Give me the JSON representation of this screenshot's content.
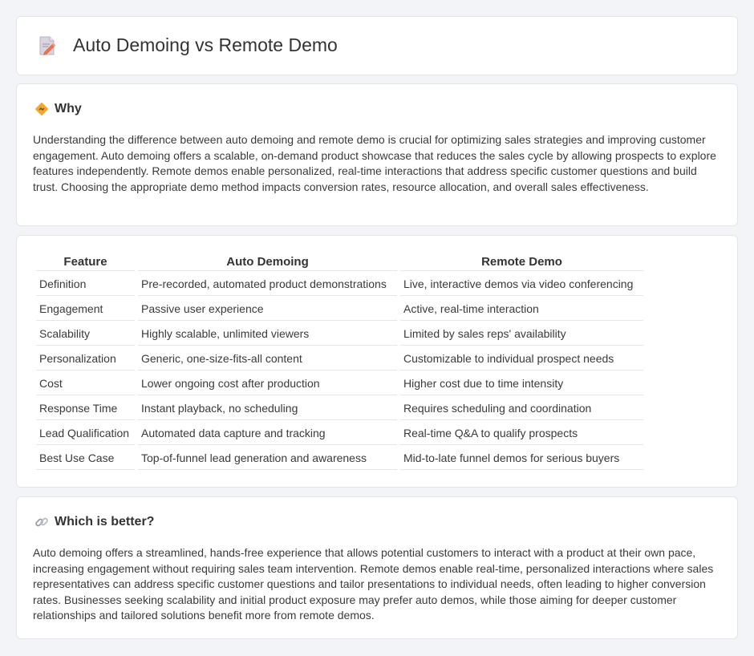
{
  "header": {
    "title": "Auto Demoing vs Remote Demo",
    "icon": "pencil-document-icon"
  },
  "why": {
    "title": "Why",
    "icon": "diamond-sign-icon",
    "text": "Understanding the difference between auto demoing and remote demo is crucial for optimizing sales strategies and improving customer engagement. Auto demoing offers a scalable, on-demand product showcase that reduces the sales cycle by allowing prospects to explore features independently. Remote demos enable personalized, real-time interactions that address specific customer questions and build trust. Choosing the appropriate demo method impacts conversion rates, resource allocation, and overall sales effectiveness."
  },
  "table": {
    "headers": [
      "Feature",
      "Auto Demoing",
      "Remote Demo"
    ],
    "rows": [
      [
        "Definition",
        "Pre-recorded, automated product demonstrations",
        "Live, interactive demos via video conferencing"
      ],
      [
        "Engagement",
        "Passive user experience",
        "Active, real-time interaction"
      ],
      [
        "Scalability",
        "Highly scalable, unlimited viewers",
        "Limited by sales reps' availability"
      ],
      [
        "Personalization",
        "Generic, one-size-fits-all content",
        "Customizable to individual prospect needs"
      ],
      [
        "Cost",
        "Lower ongoing cost after production",
        "Higher cost due to time intensity"
      ],
      [
        "Response Time",
        "Instant playback, no scheduling",
        "Requires scheduling and coordination"
      ],
      [
        "Lead Qualification",
        "Automated data capture and tracking",
        "Real-time Q&A to qualify prospects"
      ],
      [
        "Best Use Case",
        "Top-of-funnel lead generation and awareness",
        "Mid-to-late funnel demos for serious buyers"
      ]
    ]
  },
  "better": {
    "title": "Which is better?",
    "icon": "link-icon",
    "text": "Auto demoing offers a streamlined, hands-free experience that allows potential customers to interact with a product at their own pace, increasing engagement without requiring sales team intervention. Remote demos enable real-time, personalized interactions where sales representatives can address specific customer questions and tailor presentations to individual needs, often leading to higher conversion rates. Businesses seeking scalability and initial product exposure may prefer auto demos, while those aiming for deeper customer relationships and tailored solutions benefit more from remote demos."
  },
  "colors": {
    "background": "#f3f4f8",
    "card": "#ffffff",
    "icon_orange": "#f0a830",
    "icon_pink": "#e0607a"
  }
}
